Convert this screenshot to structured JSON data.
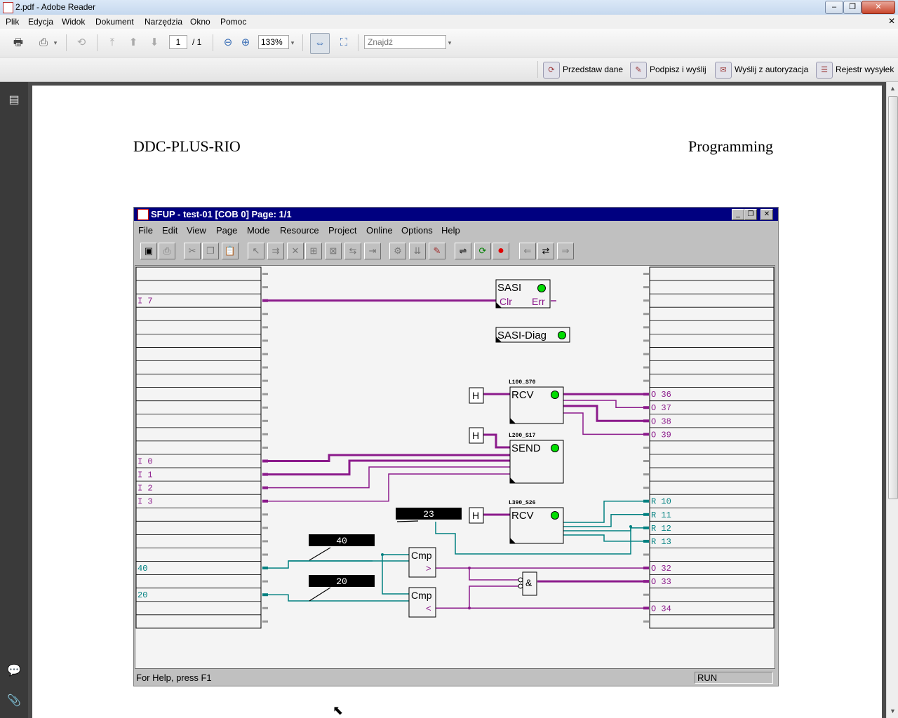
{
  "window": {
    "title": "2.pdf - Adobe Reader"
  },
  "menu": [
    "Plik",
    "Edycja",
    "Widok",
    "Dokument",
    "Narzędzia",
    "Okno",
    "Pomoc"
  ],
  "toolbar": {
    "page_current": "1",
    "page_total": "/ 1",
    "zoom": "133%",
    "find_placeholder": "Znajdź"
  },
  "actions": [
    {
      "label": "Przedstaw dane",
      "icon": "present-data-icon"
    },
    {
      "label": "Podpisz i wyślij",
      "icon": "sign-send-icon"
    },
    {
      "label": "Wyślij z autoryzacja",
      "icon": "send-auth-icon"
    },
    {
      "label": "Rejestr wysyłek",
      "icon": "send-log-icon"
    }
  ],
  "document": {
    "header_left": "DDC-PLUS-RIO",
    "header_right": "Programming"
  },
  "sfup": {
    "title": "SFUP - test-01 [COB 0] Page: 1/1",
    "menu": [
      "File",
      "Edit",
      "View",
      "Page",
      "Mode",
      "Resource",
      "Project",
      "Online",
      "Options",
      "Help"
    ],
    "status_help": "For Help, press F1",
    "status_mode": "RUN",
    "left_signals": [
      {
        "row": 2,
        "label": "I 7",
        "color": "purple"
      },
      {
        "row": 14,
        "label": "I 0",
        "color": "purple"
      },
      {
        "row": 15,
        "label": "I 1",
        "color": "purple"
      },
      {
        "row": 16,
        "label": "I 2",
        "color": "purple"
      },
      {
        "row": 17,
        "label": "I 3",
        "color": "purple"
      },
      {
        "row": 22,
        "label": "40",
        "color": "teal"
      },
      {
        "row": 24,
        "label": "20",
        "color": "teal"
      }
    ],
    "right_signals": [
      {
        "row": 9,
        "label": "O 36",
        "color": "purple"
      },
      {
        "row": 10,
        "label": "O 37",
        "color": "purple"
      },
      {
        "row": 11,
        "label": "O 38",
        "color": "purple"
      },
      {
        "row": 12,
        "label": "O 39",
        "color": "purple"
      },
      {
        "row": 17,
        "label": "R 10",
        "color": "teal"
      },
      {
        "row": 18,
        "label": "R 11",
        "color": "teal"
      },
      {
        "row": 19,
        "label": "R 12",
        "color": "teal"
      },
      {
        "row": 20,
        "label": "R 13",
        "color": "teal"
      },
      {
        "row": 22,
        "label": "O 32",
        "color": "purple"
      },
      {
        "row": 23,
        "label": "O 33",
        "color": "purple"
      },
      {
        "row": 25,
        "label": "O 34",
        "color": "purple"
      }
    ],
    "blocks": {
      "sasi": {
        "name": "SASI",
        "pin_clr": "Clr",
        "pin_err": "Err"
      },
      "sasi_diag": {
        "name": "SASI-Diag"
      },
      "rcv1": {
        "name": "RCV",
        "tag": "L100_S70",
        "h": "H"
      },
      "send": {
        "name": "SEND",
        "tag": "L200_S17",
        "h": "H"
      },
      "rcv2": {
        "name": "RCV",
        "tag": "L390_S26",
        "h": "H"
      },
      "cmp1": {
        "name": "Cmp",
        "op": ">"
      },
      "cmp2": {
        "name": "Cmp",
        "op": "<"
      },
      "and": {
        "name": "&"
      },
      "const_23": "23",
      "const_40": "40",
      "const_20": "20"
    }
  },
  "colors": {
    "purple": "#8b1a8b",
    "teal": "#008080",
    "led": "#00dd00",
    "stop": "#ee0000"
  }
}
